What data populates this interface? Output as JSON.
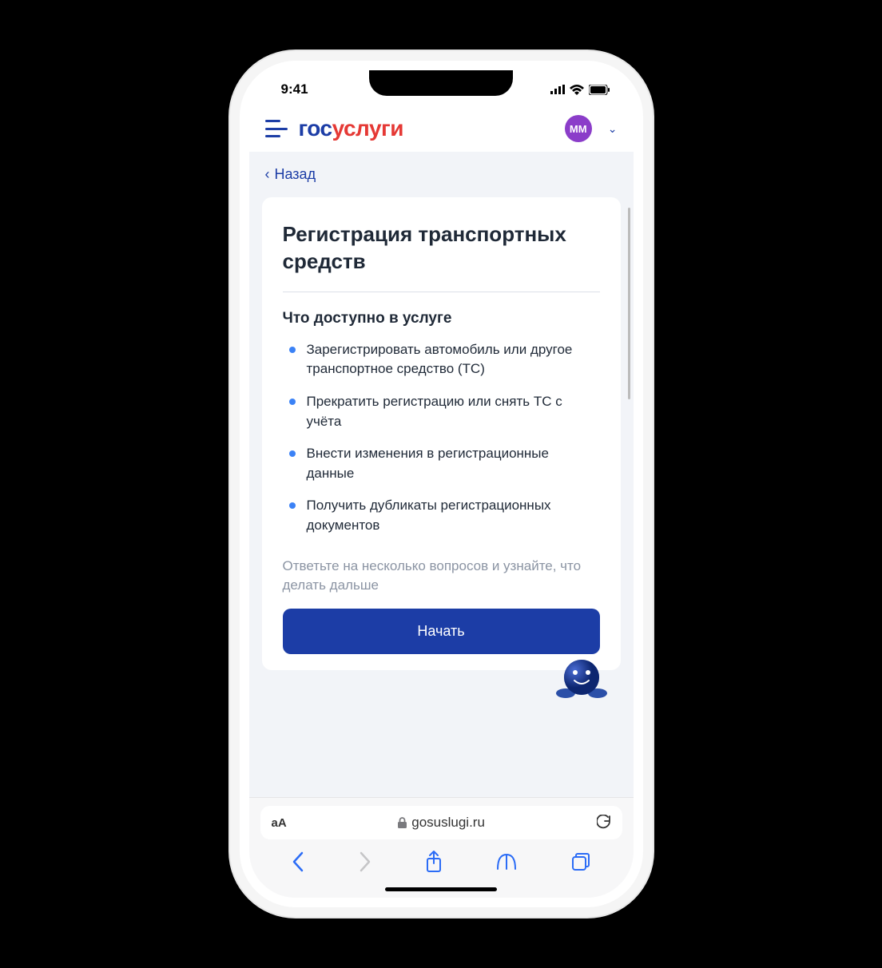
{
  "status": {
    "time": "9:41"
  },
  "header": {
    "logo_p1": "гос",
    "logo_p2": "услуги",
    "avatar_initials": "ММ"
  },
  "nav": {
    "back_label": "Назад"
  },
  "card": {
    "title": "Регистрация транспортных средств",
    "subtitle": "Что доступно в услуге",
    "items": [
      "Зарегистрировать автомобиль или другое транспортное средство (ТС)",
      "Прекратить регистрацию или снять ТС с учёта",
      "Внести изменения в регистрационные данные",
      "Получить дубликаты регистрационных документов"
    ],
    "note": "Ответьте на несколько вопросов и узнайте, что делать дальше",
    "start_label": "Начать"
  },
  "browser": {
    "text_size_label": "аА",
    "domain": "gosuslugi.ru"
  },
  "colors": {
    "primary_blue": "#1c3da6",
    "accent_red": "#e53935",
    "bullet_blue": "#3b82f6",
    "avatar_purple": "#8b3dc9"
  }
}
